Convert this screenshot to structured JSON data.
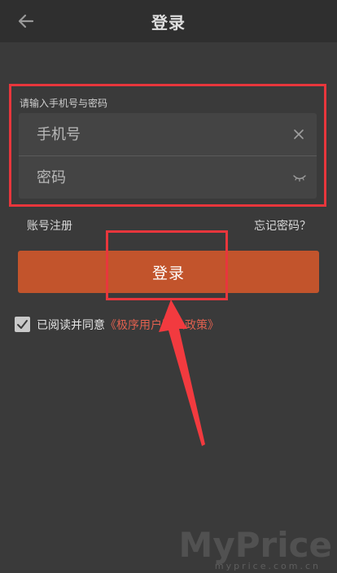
{
  "header": {
    "title": "登录",
    "back_icon": "arrow-left-icon"
  },
  "form": {
    "hint": "请输入手机号与密码",
    "phone": {
      "placeholder": "手机号",
      "value": "",
      "action_icon": "close-icon"
    },
    "password": {
      "placeholder": "密码",
      "value": "",
      "action_icon": "eye-closed-icon"
    }
  },
  "links": {
    "register": "账号注册",
    "forgot": "忘记密码？"
  },
  "login_button": {
    "label": "登录",
    "color": "#c2542c"
  },
  "agreement": {
    "checked": true,
    "text": "已阅读并同意",
    "policy": "《极序用户隐私政策》",
    "policy_color": "#e0604f"
  },
  "annotation": {
    "color": "#e8363c"
  },
  "watermark": {
    "brand": "MyPrice",
    "url": "myprice.com.cn"
  }
}
